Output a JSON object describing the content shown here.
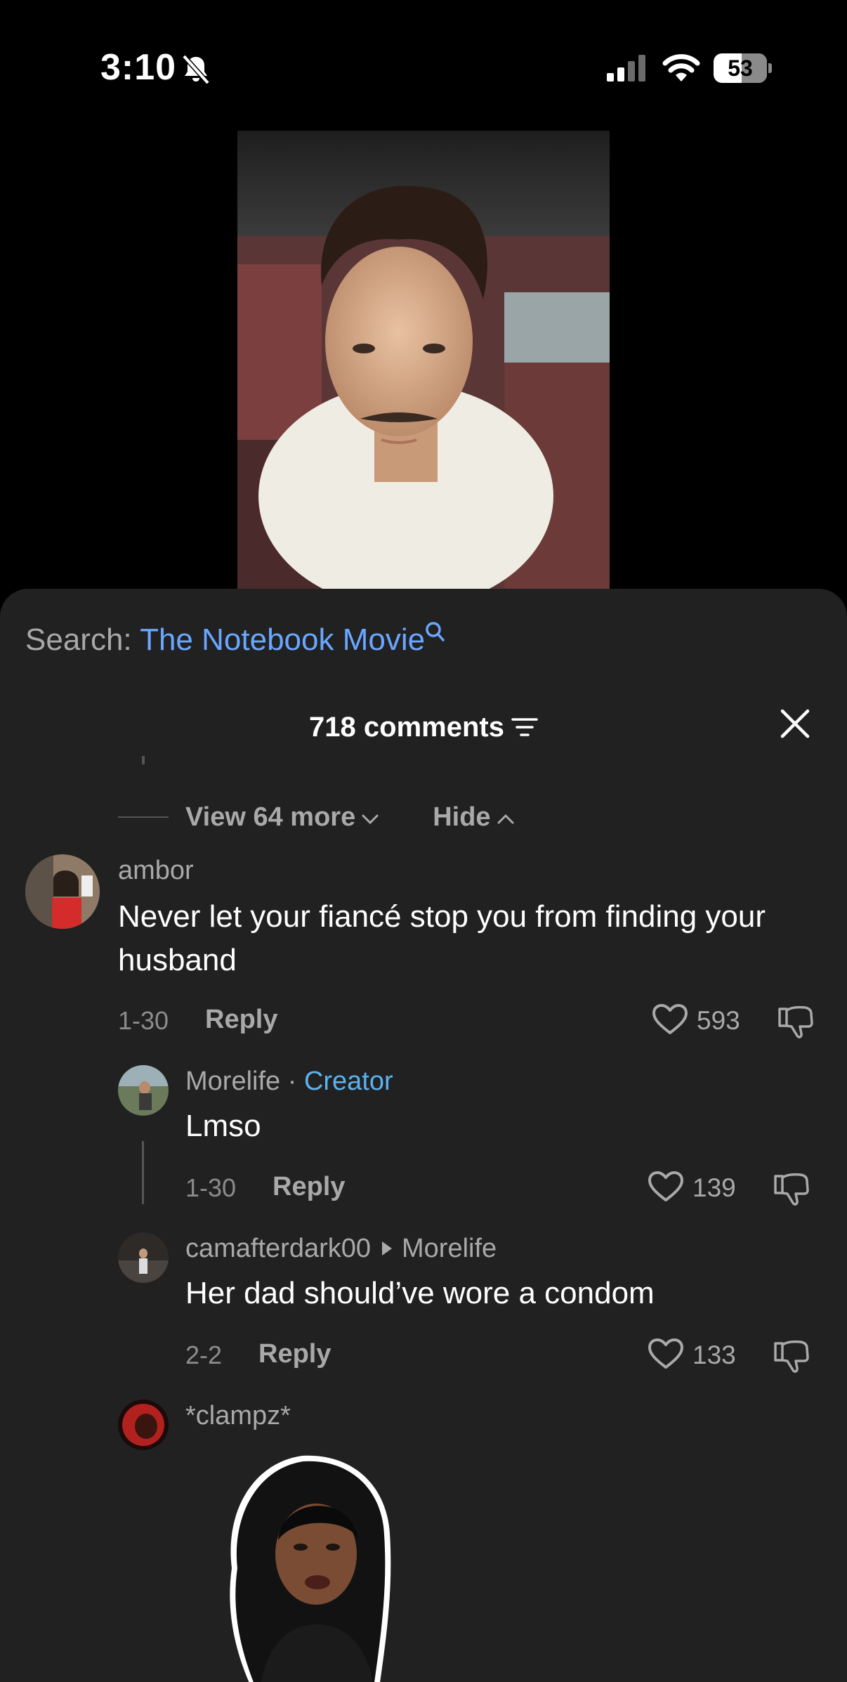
{
  "status_bar": {
    "time": "3:10",
    "battery": "53",
    "battery_fraction": 0.53,
    "icons": [
      "bell-slash-icon",
      "cellular-signal-icon",
      "wifi-icon",
      "battery-icon"
    ]
  },
  "search": {
    "label": "Search:",
    "term": "The Notebook Movie"
  },
  "comments_header": {
    "count_label": "718 comments"
  },
  "thread_controls": {
    "view_more": "View 64 more",
    "hide": "Hide"
  },
  "comments": [
    {
      "username": "ambor",
      "text": "Never let your fiancé stop you from finding your husband",
      "date": "1-30",
      "reply_label": "Reply",
      "likes": "593"
    }
  ],
  "replies": [
    {
      "username": "Morelife",
      "creator_separator": "·",
      "creator_badge": "Creator",
      "text": "Lmso",
      "date": "1-30",
      "reply_label": "Reply",
      "likes": "139"
    },
    {
      "username": "camafterdark00",
      "reply_to": "Morelife",
      "text": "Her dad should’ve wore a condom",
      "date": "2-2",
      "reply_label": "Reply",
      "likes": "133"
    },
    {
      "username": "*clampz*"
    }
  ],
  "colors": {
    "background": "#000000",
    "sheet": "#212121",
    "link_blue": "#6aa6ff",
    "creator_blue": "#5bb2ee",
    "muted_text": "#a9a9a9"
  }
}
